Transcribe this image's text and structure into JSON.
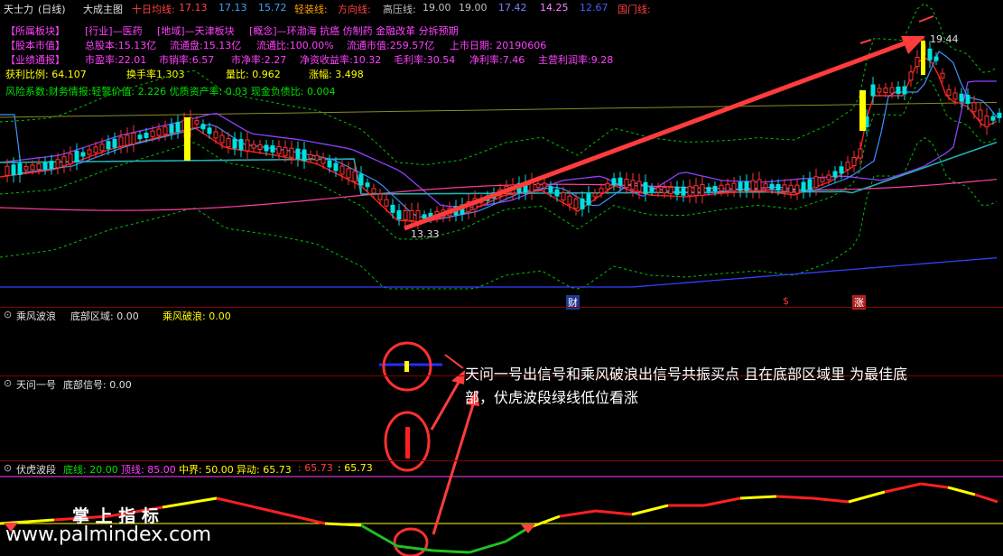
{
  "header": {
    "app_name": "天士力",
    "period": "(日线)",
    "indicator": "大成主图",
    "ma10_label": "十日均线:",
    "ma10_val": "17.13",
    "v2": "17.13",
    "v3": "15.72",
    "light_label": "轻装线:",
    "dir_label": "方向线:",
    "high_label": "高压线:",
    "high_v1": "19.00",
    "high_v2": "19.00",
    "v6": "17.42",
    "v7": "14.25",
    "v8": "12.67",
    "gate_label": "国门线:"
  },
  "info": {
    "row1": [
      "【所属板块】",
      "[行业]—医药",
      "[地域]—天津板块",
      "[概念]—环渤海 抗癌 仿制药 金融改革 分拆预期"
    ],
    "row2": [
      "【股本市值】",
      "总股本:15.13亿",
      "流通盘:15.13亿",
      "流通比:100.00%",
      "流通市值:259.57亿",
      "上市日期: 20190606"
    ],
    "row3": [
      "【业绩通报】",
      "市盈率:22.01",
      "市销率:6.57",
      "市净率:2.27",
      "净资收益率:10.32",
      "毛利率:30.54",
      "净利率:7.46",
      "主营利润率:9.28"
    ],
    "row4": [
      "获利比例:  64.107",
      "换手率1.303",
      "量比:  0.962",
      "涨幅:  3.498"
    ],
    "row5": "风险系数:财务情报:轻警价值: 2.226 优质资产率: 0.03 现金负债比: 0.004"
  },
  "annotations": {
    "high_price": "19.44",
    "low_price": "13.33",
    "marker_cai": "财",
    "marker_s": "$",
    "marker_zhang": "涨"
  },
  "panel1": {
    "name": "乘风波浪",
    "label1": "底部区域: 0.00",
    "label2": "乘风破浪: 0.00"
  },
  "panel2": {
    "name": "天问一号",
    "label1": "底部信号: 0.00"
  },
  "panel3": {
    "name": "伏虎波段",
    "bottom": "底线: 20.00",
    "top": "顶线: 85.00",
    "mid": "中界: 50.00",
    "move": "异动: 65.73",
    "v1": ": 65.73",
    "v2": ": 65.73"
  },
  "callout": {
    "line1": "天问一号出信号和乘风破浪出信号共振买点 且在底部区域里 为最佳底",
    "line2": "部，伏虎波段绿线低位看涨"
  },
  "watermark": {
    "cn": "掌 上 指 标",
    "url": "www.palmindex.com"
  },
  "colors": {
    "up": "#ff3232",
    "down": "#00e0e0",
    "yellow": "#ffff00",
    "arrow": "#ff3c3c"
  }
}
